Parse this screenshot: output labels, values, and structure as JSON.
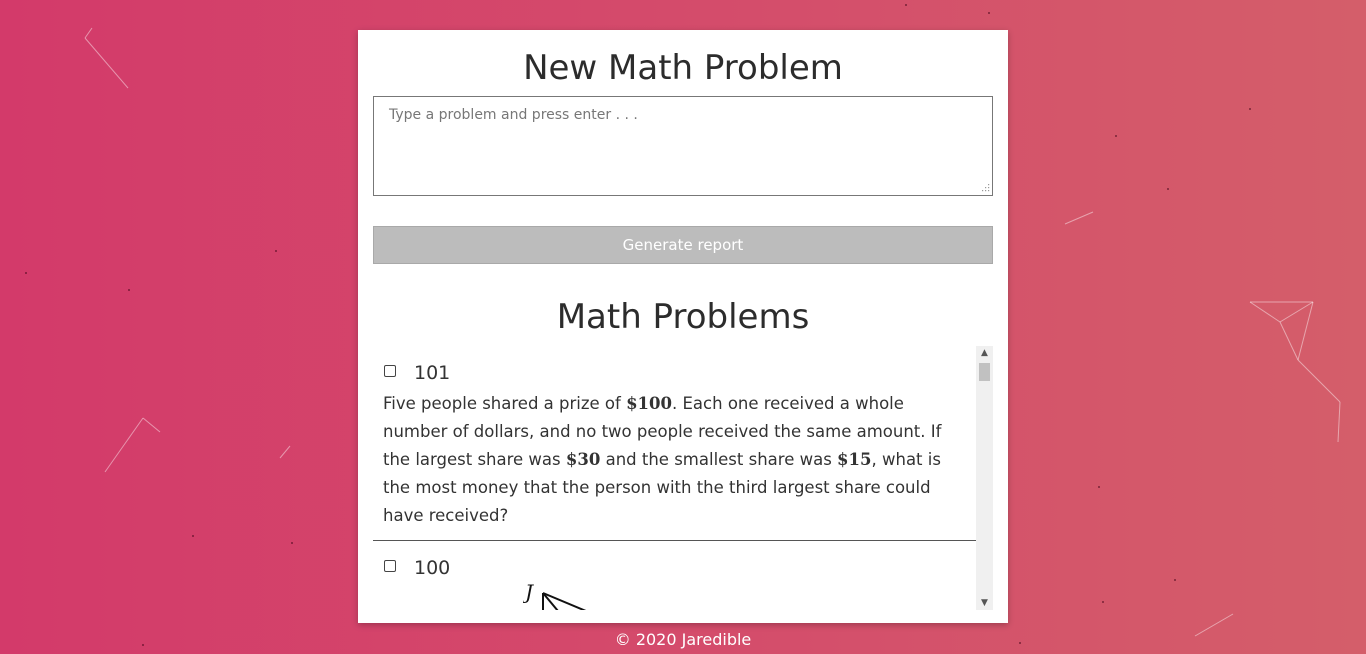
{
  "app": {
    "editor_title": "New Math Problem",
    "input_placeholder": "Type a problem and press enter . . .",
    "generate_button": "Generate report",
    "list_title": "Math Problems",
    "footer": "© 2020 Jaredible"
  },
  "problems": [
    {
      "number": "101",
      "checked": false,
      "text_parts": [
        {
          "t": "Five people shared a prize of "
        },
        {
          "t": "$100",
          "math": true
        },
        {
          "t": ". Each one received a whole number of dollars, and no two people received the same amount. If the largest share was "
        },
        {
          "t": "$30",
          "math": true
        },
        {
          "t": " and the smallest share was "
        },
        {
          "t": "$15",
          "math": true
        },
        {
          "t": ", what is the most money that the person with the third largest share could have received?"
        }
      ]
    },
    {
      "number": "100",
      "checked": false,
      "figure_label": "J"
    }
  ],
  "colors": {
    "background_start": "#d33a6a",
    "background_end": "#d45e6a",
    "button": "#bcbcbc"
  }
}
